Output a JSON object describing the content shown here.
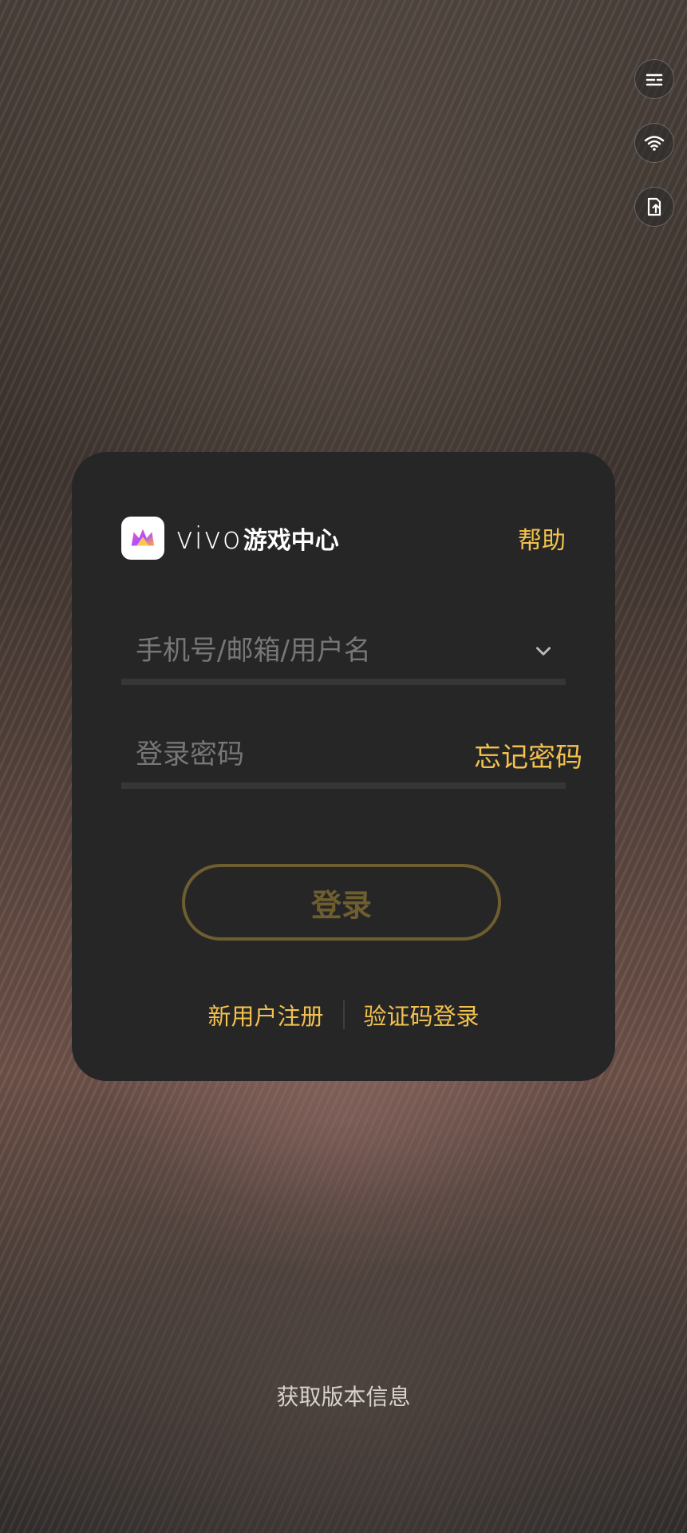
{
  "side_tools": {
    "items": [
      {
        "icon": "menu-icon"
      },
      {
        "icon": "wifi-icon"
      },
      {
        "icon": "upload-file-icon"
      }
    ]
  },
  "card": {
    "brand": {
      "logo_icon": "crown-icon",
      "vivo_text": "vivo",
      "name": "游戏中心"
    },
    "help_label": "帮助",
    "account_field": {
      "placeholder": "手机号/邮箱/用户名",
      "value": ""
    },
    "password_field": {
      "placeholder": "登录密码",
      "value": ""
    },
    "forgot_label": "忘记密码",
    "login_label": "登录",
    "register_label": "新用户注册",
    "sms_login_label": "验证码登录"
  },
  "footer": {
    "version_label": "获取版本信息"
  },
  "colors": {
    "accent": "#f2c14e",
    "card_bg": "#262626",
    "login_disabled": "#6e5e2f"
  }
}
